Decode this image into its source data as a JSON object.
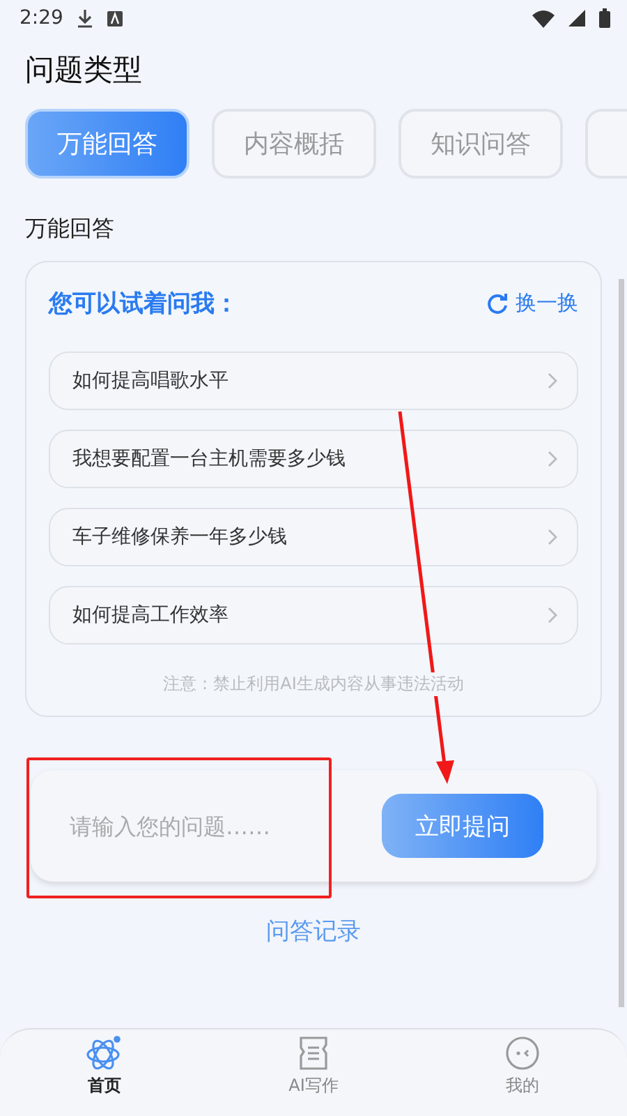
{
  "status_bar": {
    "time": "2:29"
  },
  "title": "问题类型",
  "tabs": [
    {
      "label": "万能回答",
      "selected": true
    },
    {
      "label": "内容概括",
      "selected": false
    },
    {
      "label": "知识问答",
      "selected": false
    },
    {
      "selected": false
    }
  ],
  "section_label": "万能回答",
  "suggestions": {
    "heading": "您可以试着问我：",
    "refresh": "换一换",
    "items": [
      "如何提高唱歌水平",
      "我想要配置一台主机需要多少钱",
      "车子维修保养一年多少钱",
      "如何提高工作效率"
    ],
    "note": "注意：禁止利用AI生成内容从事违法活动"
  },
  "ask": {
    "placeholder": "请输入您的问题……",
    "button": "立即提问"
  },
  "history_link": "问答记录",
  "bottom_nav": [
    {
      "label": "首页",
      "selected": true,
      "kind": "atom"
    },
    {
      "label": "AI写作",
      "selected": false,
      "kind": "note"
    },
    {
      "label": "我的",
      "selected": false,
      "kind": "face"
    }
  ]
}
